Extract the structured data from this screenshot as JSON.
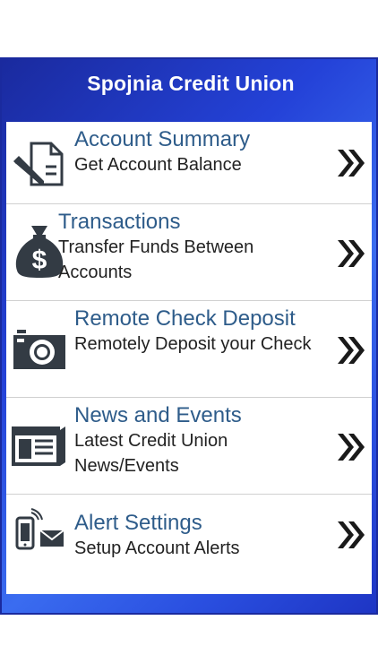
{
  "app": {
    "title": "Spojnia Credit Union"
  },
  "menu": {
    "items": [
      {
        "icon": "document-pen-icon",
        "title": "Account Summary",
        "subtitle": "Get Account Balance"
      },
      {
        "icon": "money-bag-icon",
        "title": "Transactions",
        "subtitle": "Transfer Funds Between Accounts"
      },
      {
        "icon": "camera-icon",
        "title": "Remote Check Deposit",
        "subtitle": "Remotely Deposit your Check"
      },
      {
        "icon": "newspaper-icon",
        "title": "News and Events",
        "subtitle": "Latest Credit Union News/Events"
      },
      {
        "icon": "phone-alert-icon",
        "title": "Alert Settings",
        "subtitle": "Setup Account Alerts"
      }
    ],
    "arrow_icon": "double-chevron-right-icon"
  },
  "colors": {
    "header_gradient_dark": "#1a2a9e",
    "header_gradient_light": "#3a6cf0",
    "title_text": "#2e5c8a",
    "icon_dark": "#333b44"
  }
}
